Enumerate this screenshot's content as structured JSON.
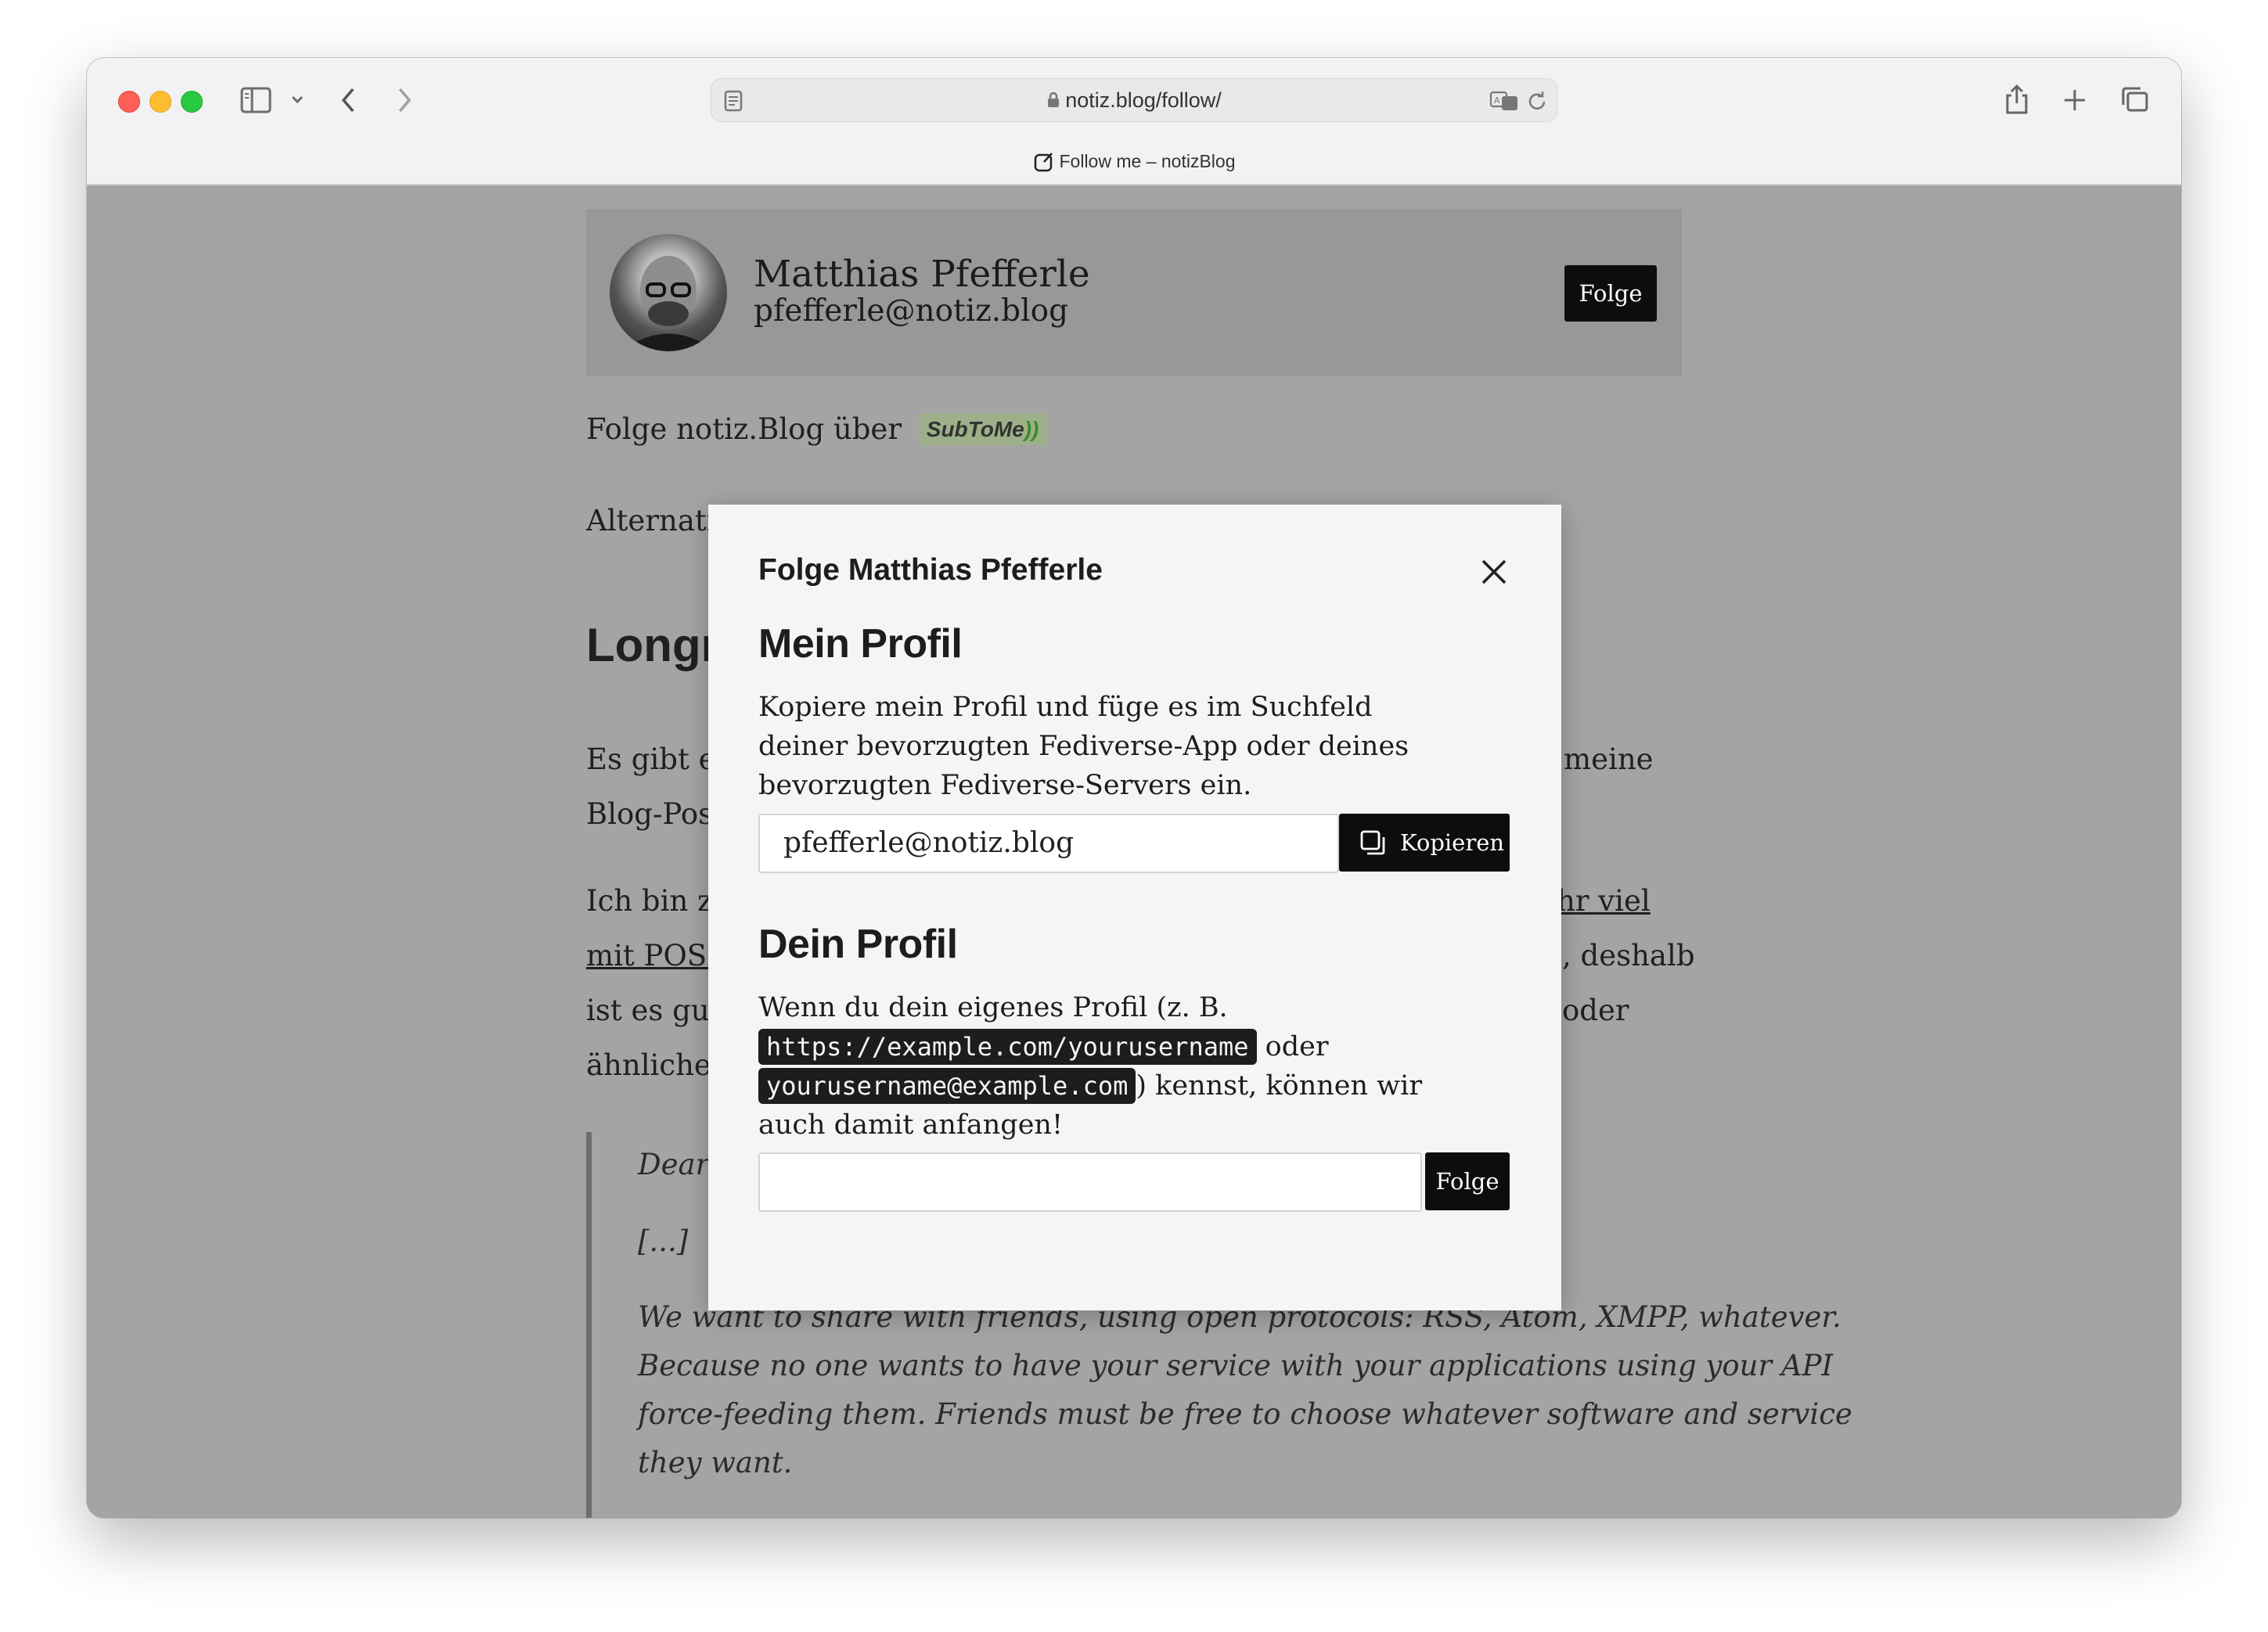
{
  "browser": {
    "url": "notiz.blog/follow/",
    "tab_title": "Follow me – notizBlog"
  },
  "profile_card": {
    "name": "Matthias Pfefferle",
    "handle": "pfefferle@notiz.blog",
    "follow_button": "Folge"
  },
  "background_page": {
    "follow_line": "Folge notiz.Blog über",
    "subtome_badge": "SubToMe",
    "alternative_line": "Alternati",
    "heading": "Longr",
    "p1_line1_start": "Es gibt ei",
    "p1_line1_end": "meine",
    "p1_line2_start": "Blog-Pos",
    "p2_line1_start": "Ich bin zu",
    "p2_line1_end": "hr viel",
    "p2_line2_start": "mit POSS",
    "p2_line2_end": ", deshalb",
    "p2_line3_start": "ist es gut",
    "p2_line3_end": "oder",
    "p2_line4_start": "ähnliche",
    "quote_line1": "Dear",
    "quote_line2": "[...]",
    "quote_line3": "We want to share with friends, using open protocols: RSS, Atom, XMPP, whatever.",
    "quote_line4": "Because no one wants to have your service with your applications using your API",
    "quote_line5": "force-feeding them. Friends must be free to choose whatever software and service",
    "quote_line6": "they want."
  },
  "modal": {
    "title": "Folge Matthias Pfefferle",
    "my_profile": {
      "heading": "Mein Profil",
      "description": "Kopiere mein Profil und füge es im Suchfeld deiner bevorzugten Fediverse-App oder deines bevorzugten Fediverse-Servers ein.",
      "handle_value": "pfefferle@notiz.blog",
      "copy_button": "Kopieren"
    },
    "your_profile": {
      "heading": "Dein Profil",
      "desc_start": "Wenn du dein eigenes Profil (z. B.",
      "code_example_1": "https://example.com/yourusername",
      "desc_middle": "oder",
      "code_example_2": "yourusername@example.com",
      "desc_end": ") kennst, können wir auch damit anfangen!",
      "input_value": "",
      "follow_button": "Folge"
    }
  }
}
